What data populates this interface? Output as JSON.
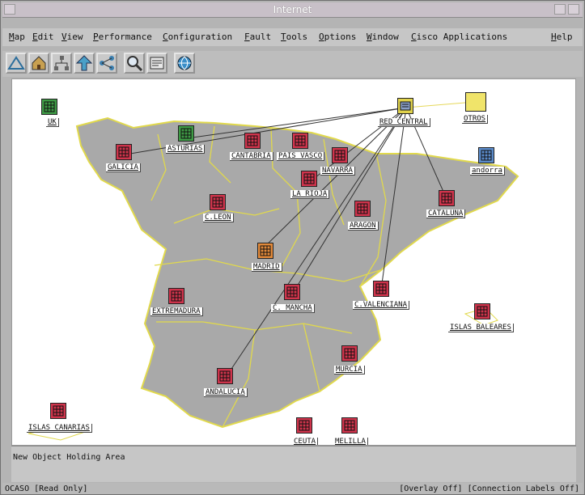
{
  "window": {
    "title": "Internet"
  },
  "menu": [
    "Map",
    "Edit",
    "View",
    "Performance",
    "Configuration",
    "Fault",
    "Tools",
    "Options",
    "Window",
    "Cisco Applications",
    "Help"
  ],
  "toolbar": {
    "buttons": [
      "triangle-tool-icon",
      "home-icon",
      "tree-icon",
      "up-arrow-icon",
      "network-icon",
      "zoom-icon",
      "panel-icon",
      "globe-icon"
    ]
  },
  "colors": {
    "critical": "#d0344c",
    "normal": "#3e9b45",
    "unknown": "#5b8ccc",
    "major": "#e38a3a",
    "warning": "#f0e46a",
    "minor": "#d9d24a",
    "map": "#a9a9a9"
  },
  "nodes": [
    {
      "label": "UK",
      "status": "normal"
    },
    {
      "label": "ASTURIAS",
      "status": "normal"
    },
    {
      "label": "GALICIA",
      "status": "critical"
    },
    {
      "label": "CANTABRIA",
      "status": "critical"
    },
    {
      "label": "PAIS VASCO",
      "status": "critical"
    },
    {
      "label": "NAVARRA",
      "status": "critical"
    },
    {
      "label": "LA RIOJA",
      "status": "critical"
    },
    {
      "label": "RED CENTRAL",
      "status": "minor"
    },
    {
      "label": "OTROS",
      "status": "warning"
    },
    {
      "label": "andorra",
      "status": "unknown"
    },
    {
      "label": "CATALUNA",
      "status": "critical"
    },
    {
      "label": "ARAGON",
      "status": "critical"
    },
    {
      "label": "C.LEON",
      "status": "critical"
    },
    {
      "label": "MADRID",
      "status": "major"
    },
    {
      "label": "EXTREMADURA",
      "status": "critical"
    },
    {
      "label": "C. MANCHA",
      "status": "critical"
    },
    {
      "label": "C.VALENCIANA",
      "status": "critical"
    },
    {
      "label": "ISLAS BALEARES",
      "status": "critical"
    },
    {
      "label": "MURCIA",
      "status": "critical"
    },
    {
      "label": "ANDALUCIA",
      "status": "critical"
    },
    {
      "label": "ISLAS CANARIAS",
      "status": "critical"
    },
    {
      "label": "CEUTA",
      "status": "critical"
    },
    {
      "label": "MELILLA",
      "status": "critical"
    }
  ],
  "holding_area": {
    "label": "New Object Holding Area"
  },
  "status_bar": {
    "left": "OCASO [Read Only]",
    "right": "[Overlay Off] [Connection Labels Off]"
  }
}
